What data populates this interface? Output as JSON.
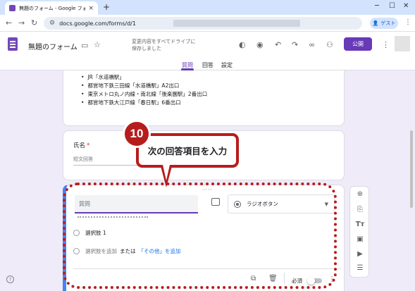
{
  "browser": {
    "tab_title": "無題のフォーム - Google フォーム",
    "url": "docs.google.com/forms/d/1",
    "guest_label": "ゲスト"
  },
  "forms_header": {
    "title": "無題のフォーム",
    "save_status_line1": "変更内容をすべてドライブに",
    "save_status_line2": "保存しました",
    "publish_label": "公開",
    "tabs": [
      {
        "label": "質問",
        "active": true
      },
      {
        "label": "回答",
        "active": false
      },
      {
        "label": "設定",
        "active": false
      }
    ]
  },
  "info_card": {
    "items": [
      "JR「水道橋駅」",
      "都営地下鉄三田線「水道橋駅」A2出口",
      "東京メトロ丸ノ内線・南北線「後楽園駅」2番出口",
      "都営地下鉄大江戸線「春日駅」6番出口"
    ]
  },
  "name_question": {
    "title": "氏名",
    "required_mark": "*",
    "short_answer_label": "短文回答"
  },
  "active_question": {
    "title_placeholder": "質問",
    "type_label": "ラジオボタン",
    "option1": "選択肢 1",
    "add_option": "選択肢を追加",
    "or_text": "または",
    "add_other": "「その他」を追加",
    "required_label": "必須"
  },
  "annotation": {
    "step_number": "10",
    "callout_text": "次の回答項目を入力",
    "accent_color": "#b71c1c"
  },
  "colors": {
    "brand_purple": "#673ab7",
    "background": "#f0ebf8",
    "active_border": "#4285f4"
  }
}
